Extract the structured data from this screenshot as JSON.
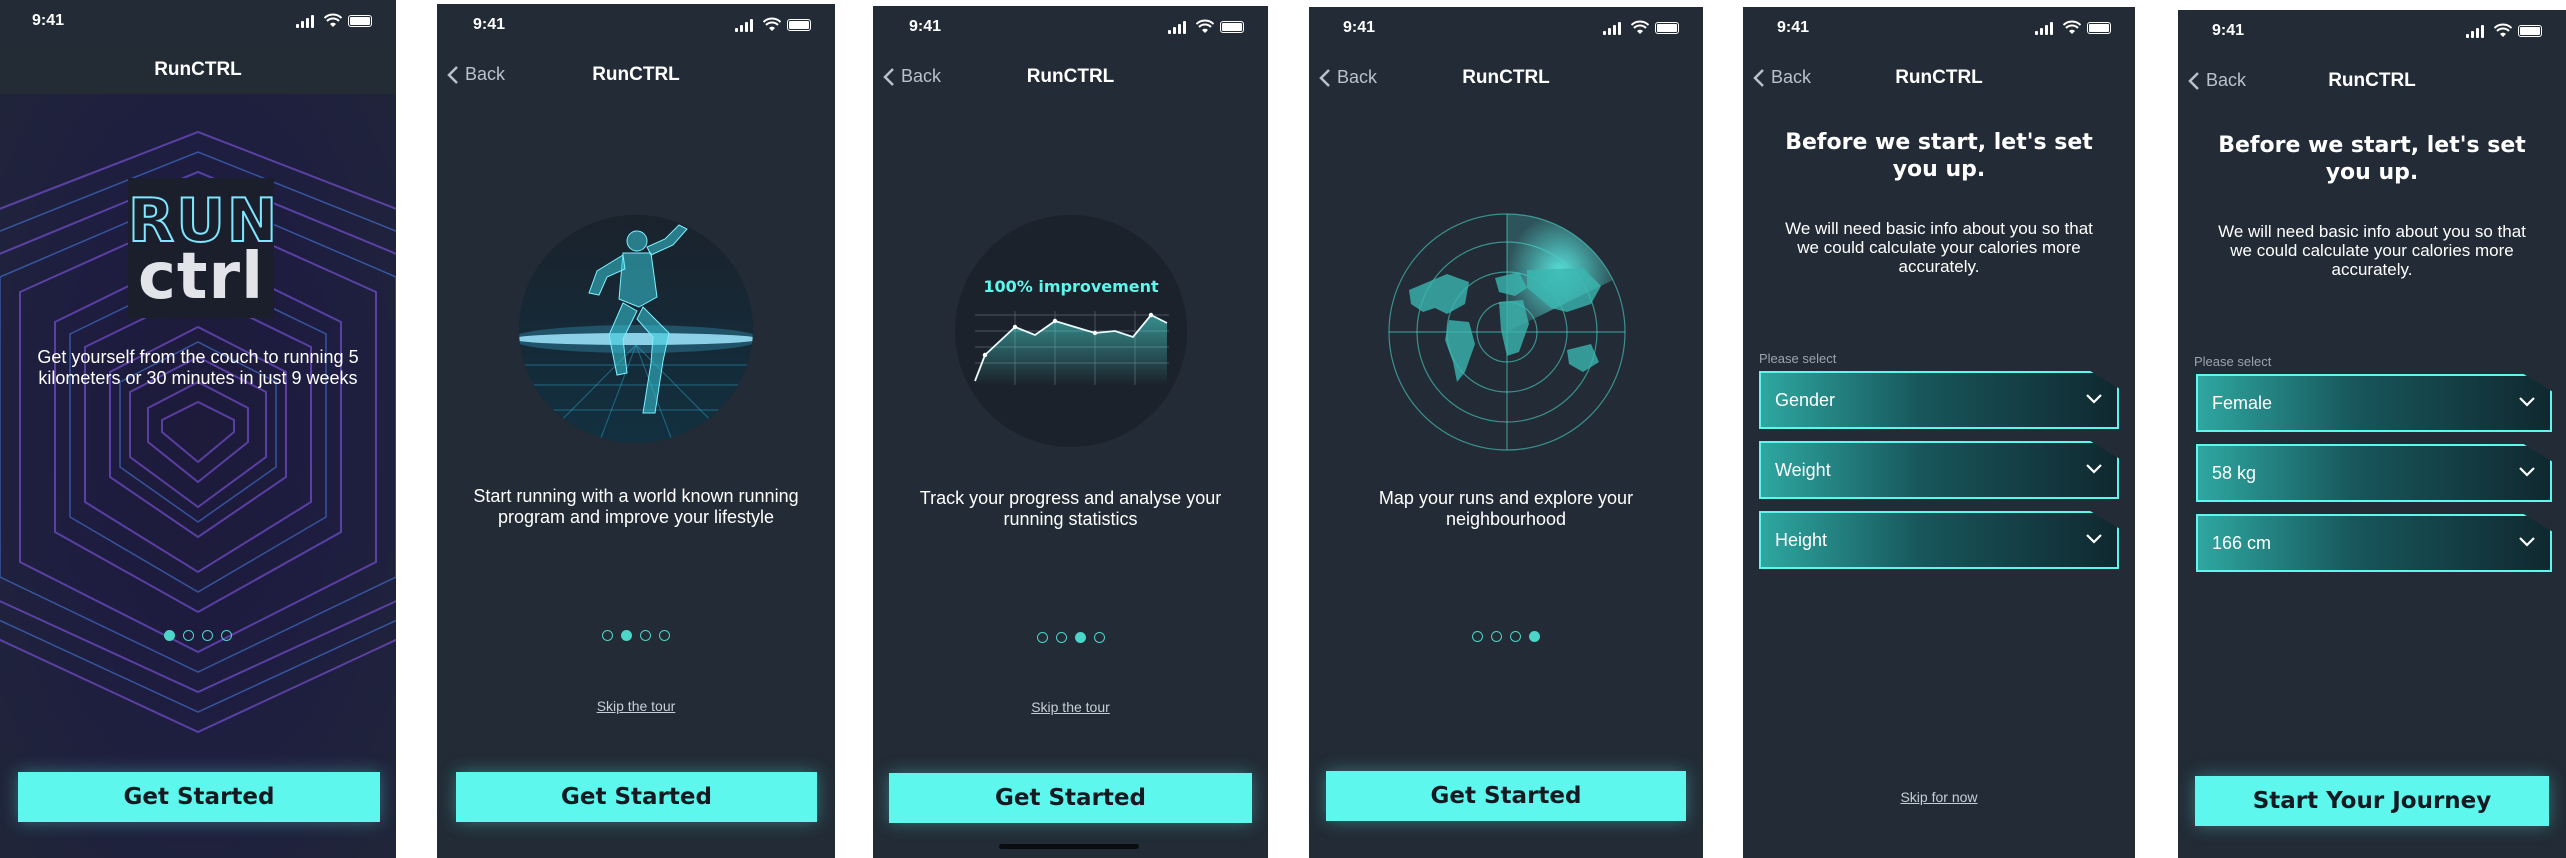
{
  "app_title": "RunCTRL",
  "status_time": "9:41",
  "back_label": "Back",
  "accent": "#5ef7ee",
  "screens": {
    "splash": {
      "logo_top": "RUN",
      "logo_bottom": "ctrl",
      "description": "Get yourself from the couch to running 5 kilometers or 30 minutes in just 9 weeks",
      "page_index": 1,
      "cta": "Get Started"
    },
    "tour1": {
      "description": "Start running with a world known running program and improve your lifestyle",
      "page_index": 2,
      "skip": "Skip the tour",
      "cta": "Get Started",
      "illustration": "runner-illustration"
    },
    "tour2": {
      "chart_caption": "100% improvement",
      "description": "Track your progress and analyse your running statistics",
      "page_index": 3,
      "skip": "Skip the tour",
      "cta": "Get Started",
      "illustration": "progress-chart-illustration"
    },
    "tour3": {
      "description": "Map your runs and explore your neighbourhood",
      "page_index": 4,
      "cta": "Get Started",
      "illustration": "radar-map-illustration"
    },
    "setup_empty": {
      "heading": "Before we start, let's set you up.",
      "subheading": "We will need basic info about you so that we could calculate your calories more accurately.",
      "please_select": "Please select",
      "fields": [
        "Gender",
        "Weight",
        "Height"
      ],
      "skip": "Skip for now"
    },
    "setup_filled": {
      "heading": "Before we start, let's set you up.",
      "subheading": "We will need basic info about you so that we could calculate your calories more accurately.",
      "please_select": "Please select",
      "fields": [
        "Female",
        "58 kg",
        "166 cm"
      ],
      "cta": "Start Your Journey"
    }
  }
}
